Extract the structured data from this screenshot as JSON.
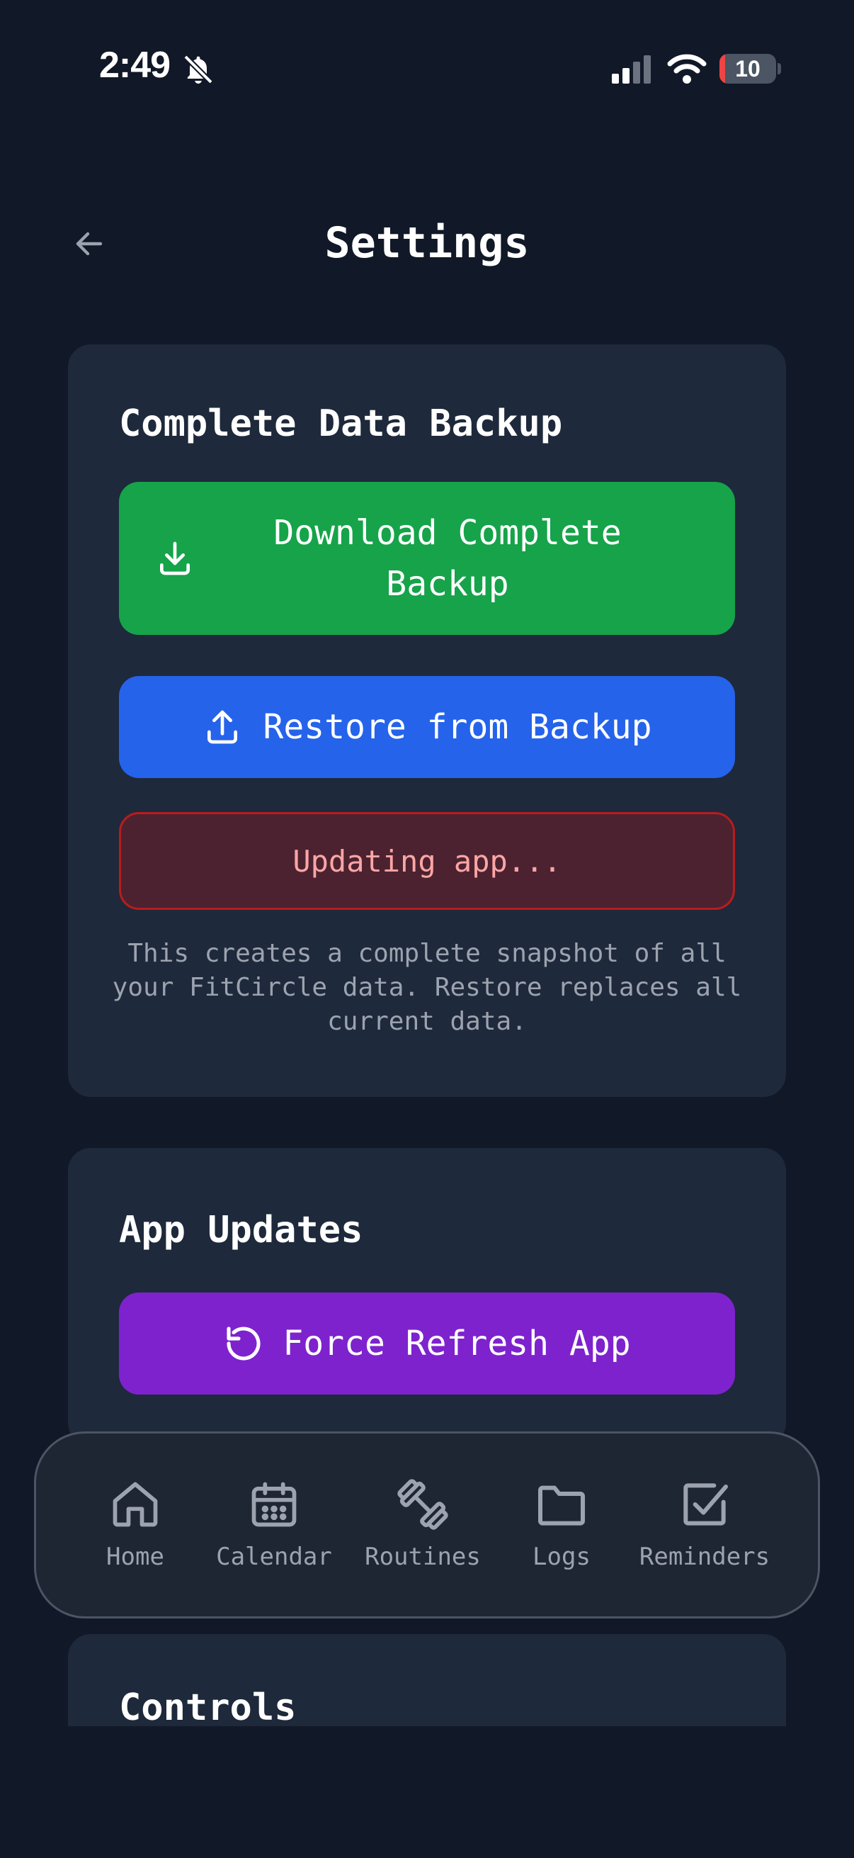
{
  "status_bar": {
    "time": "2:49",
    "battery_level": "10",
    "battery_fraction": 0.1,
    "icons": [
      "bell-slash-icon",
      "signal-icon",
      "wifi-icon",
      "battery-icon"
    ]
  },
  "header": {
    "title": "Settings",
    "back_icon": "arrow-left-icon"
  },
  "backup_card": {
    "title": "Complete Data Backup",
    "download_line1": "Download Complete",
    "download_line2": "Backup",
    "restore_label": "Restore from Backup",
    "status_text": "Updating app...",
    "note": "This creates a complete snapshot of all your FitCircle data. Restore replaces all current data."
  },
  "updates_card": {
    "title": "App Updates",
    "refresh_label": "Force Refresh App"
  },
  "controls_card": {
    "title": "Controls"
  },
  "nav": {
    "items": [
      {
        "label": "Home",
        "icon": "home-icon"
      },
      {
        "label": "Calendar",
        "icon": "calendar-icon"
      },
      {
        "label": "Routines",
        "icon": "dumbbell-icon"
      },
      {
        "label": "Logs",
        "icon": "folder-icon"
      },
      {
        "label": "Reminders",
        "icon": "checkbox-icon"
      }
    ]
  },
  "colors": {
    "background": "#111827",
    "card": "#1e293b",
    "download_green": "#16a34a",
    "restore_blue": "#2563eb",
    "refresh_purple": "#7e22ce",
    "error_border": "#b91c1c",
    "error_text": "#fca5a5",
    "muted_text": "#9ca3af"
  }
}
